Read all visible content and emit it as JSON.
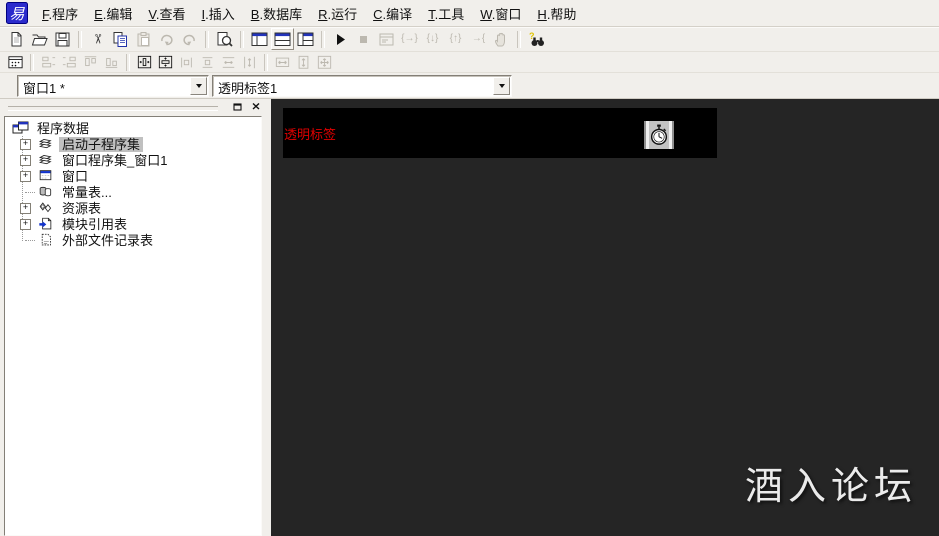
{
  "logo_icon": "elang-logo-icon",
  "menu": {
    "items": [
      {
        "key": "F",
        "label": "程序"
      },
      {
        "key": "E",
        "label": "编辑"
      },
      {
        "key": "V",
        "label": "查看"
      },
      {
        "key": "I",
        "label": "插入"
      },
      {
        "key": "B",
        "label": "数据库"
      },
      {
        "key": "R",
        "label": "运行"
      },
      {
        "key": "C",
        "label": "编译"
      },
      {
        "key": "T",
        "label": "工具"
      },
      {
        "key": "W",
        "label": "窗口"
      },
      {
        "key": "H",
        "label": "帮助"
      }
    ]
  },
  "toolbar_main": {
    "buttons": [
      {
        "name": "new",
        "icon": "new-file-icon"
      },
      {
        "name": "open",
        "icon": "open-file-icon"
      },
      {
        "name": "save",
        "icon": "save-icon"
      },
      {
        "sep": true
      },
      {
        "name": "cut",
        "icon": "cut-icon"
      },
      {
        "name": "copy",
        "icon": "copy-icon"
      },
      {
        "name": "paste",
        "icon": "paste-icon",
        "disabled": true
      },
      {
        "name": "redo",
        "icon": "redo-icon",
        "disabled": true
      },
      {
        "name": "undo",
        "icon": "undo-icon",
        "disabled": true
      },
      {
        "sep": true
      },
      {
        "name": "find",
        "icon": "find-icon"
      },
      {
        "sep": true
      },
      {
        "name": "view-workspace",
        "icon": "layout-left-icon"
      },
      {
        "name": "view-output",
        "icon": "layout-top-icon",
        "toggled": true
      },
      {
        "name": "view-panels",
        "icon": "layout-mixed-icon"
      },
      {
        "sep": true
      },
      {
        "name": "run",
        "icon": "run-icon"
      },
      {
        "name": "stop",
        "icon": "stop-icon",
        "disabled": true
      },
      {
        "name": "debug-window",
        "icon": "debug-window-icon",
        "disabled": true
      },
      {
        "name": "step-over",
        "icon": "step-over-icon",
        "disabled": true
      },
      {
        "name": "step-into",
        "icon": "step-into-icon",
        "disabled": true
      },
      {
        "name": "step-out",
        "icon": "step-out-icon",
        "disabled": true
      },
      {
        "name": "run-to-cursor",
        "icon": "run-to-cursor-icon",
        "disabled": true
      },
      {
        "name": "pause",
        "icon": "pause-hand-icon",
        "disabled": true
      },
      {
        "sep": true
      },
      {
        "name": "help-search",
        "icon": "help-search-icon"
      }
    ]
  },
  "toolbar_align": {
    "buttons": [
      {
        "name": "form-designer",
        "icon": "form-grid-icon"
      },
      {
        "sep": true
      },
      {
        "name": "align-left",
        "icon": "align-left-icon",
        "disabled": true
      },
      {
        "name": "align-right",
        "icon": "align-right-icon",
        "disabled": true
      },
      {
        "name": "align-top",
        "icon": "align-top-icon",
        "disabled": true
      },
      {
        "name": "align-bottom",
        "icon": "align-bottom-icon",
        "disabled": true
      },
      {
        "sep": true
      },
      {
        "name": "center-horizontal",
        "icon": "center-horizontal-icon"
      },
      {
        "name": "center-vertical",
        "icon": "center-vertical-icon"
      },
      {
        "name": "space-across",
        "icon": "space-across-icon",
        "disabled": true
      },
      {
        "name": "space-down",
        "icon": "space-down-icon",
        "disabled": true
      },
      {
        "name": "make-same-width",
        "icon": "same-width-icon",
        "disabled": true
      },
      {
        "name": "make-same-height",
        "icon": "same-height-icon",
        "disabled": true
      },
      {
        "sep": true
      },
      {
        "name": "size-width",
        "icon": "resize-width-icon",
        "disabled": true
      },
      {
        "name": "size-height",
        "icon": "resize-height-icon",
        "disabled": true
      },
      {
        "name": "size-both",
        "icon": "resize-both-icon",
        "disabled": true
      }
    ]
  },
  "combo_bar": {
    "window_selector": {
      "value": "窗口1 *"
    },
    "component_selector": {
      "value": "透明标签1"
    }
  },
  "workspace_panel": {
    "title": "程序数据",
    "title_buttons": [
      {
        "name": "float",
        "icon": "restore-box-icon"
      },
      {
        "name": "close",
        "icon": "close-x-icon"
      }
    ],
    "tree": [
      {
        "label": "启动子程序集",
        "icon": "subprogram-stack-icon",
        "expandable": true,
        "selected": true
      },
      {
        "label": "窗口程序集_窗口1",
        "icon": "subprogram-stack-icon",
        "expandable": true
      },
      {
        "label": "窗口",
        "icon": "window-icon",
        "expandable": true
      },
      {
        "label": "常量表...",
        "icon": "constants-table-icon",
        "expandable": false
      },
      {
        "label": "资源表",
        "icon": "resources-table-icon",
        "expandable": true
      },
      {
        "label": "模块引用表",
        "icon": "module-refs-icon",
        "expandable": true
      },
      {
        "label": "外部文件记录表",
        "icon": "external-files-icon",
        "expandable": false
      }
    ]
  },
  "designer": {
    "form_label": "透明标签",
    "label_color": "#e00000",
    "form_bg": "#000000",
    "canvas_bg": "#252525",
    "timer_component_icon": "stopwatch-icon"
  },
  "watermark": {
    "text": "酒入论坛"
  },
  "colors": {
    "chrome_bg": "#f1efeb",
    "accent_blue": "#2233bb",
    "selection_gray": "#c0c0c0"
  }
}
